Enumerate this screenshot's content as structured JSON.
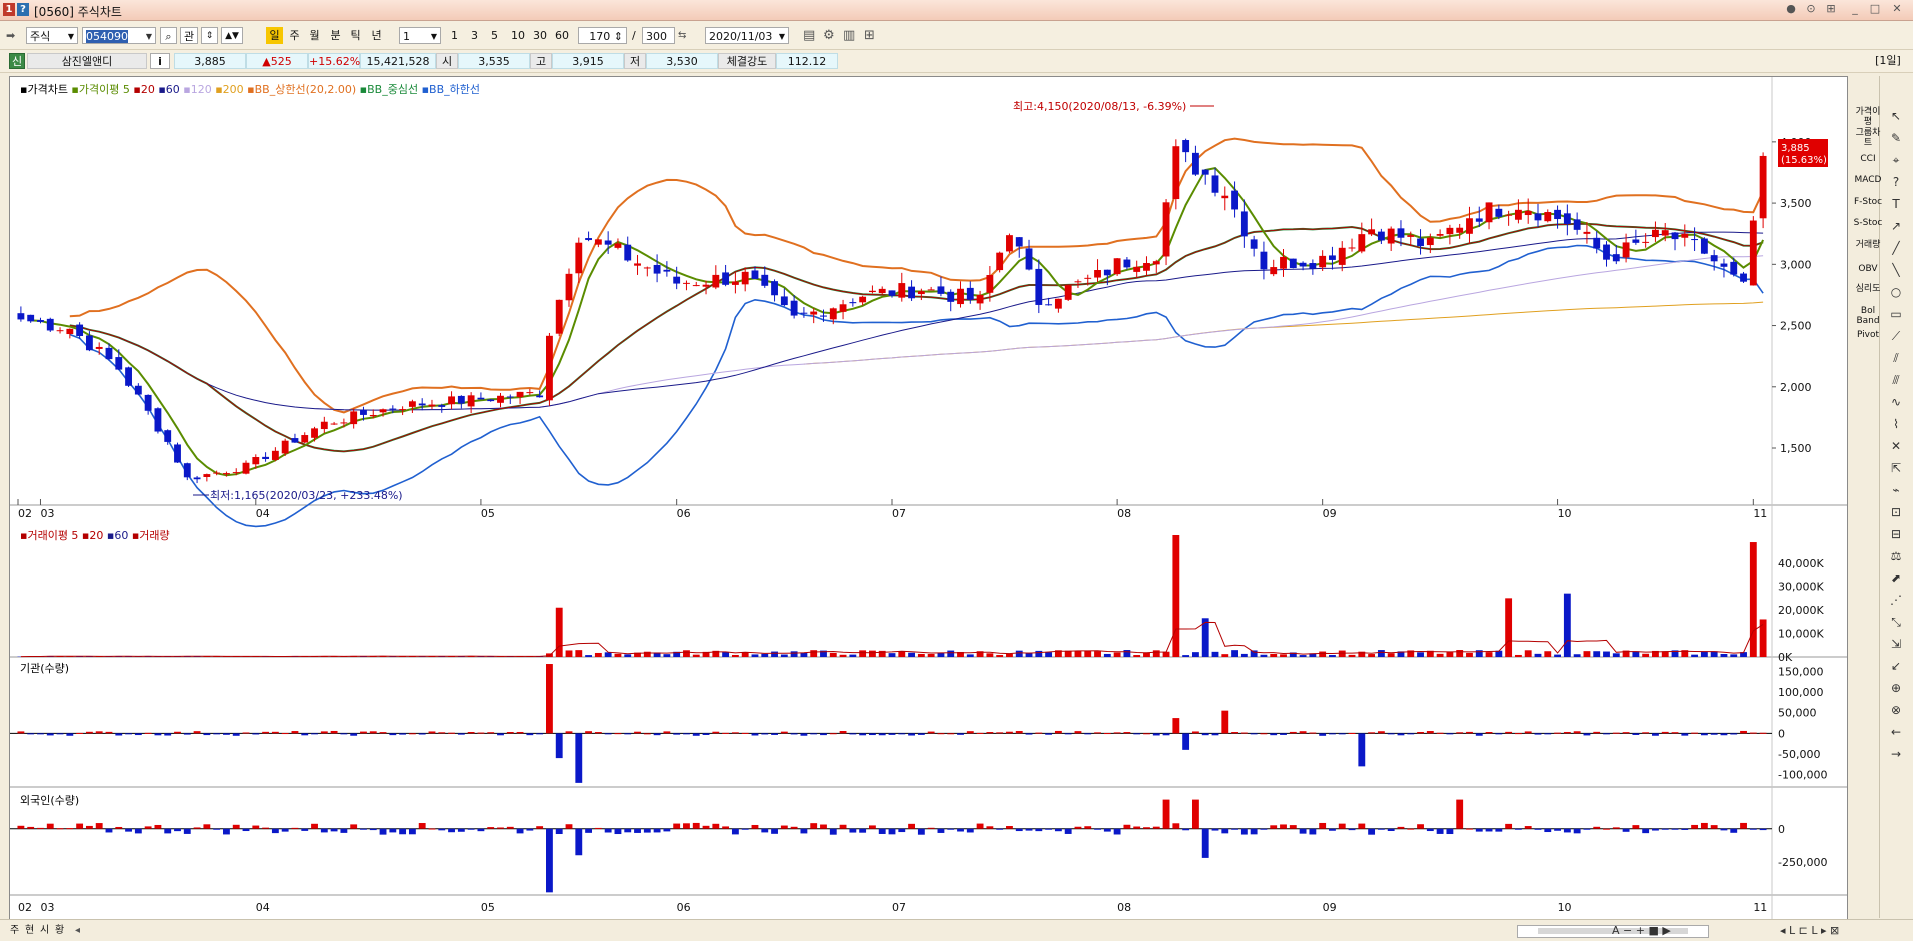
{
  "window": {
    "code": "[0560]",
    "title": "주식차트"
  },
  "toolbar": {
    "market": "주식",
    "code": "054090",
    "kwan_label": "관",
    "periods": [
      "일",
      "주",
      "월",
      "분",
      "틱",
      "년"
    ],
    "tick_value": "1",
    "minute_opts": [
      "1",
      "3",
      "5",
      "10",
      "30",
      "60"
    ],
    "count": "170",
    "total": "300",
    "date": "2020/11/03"
  },
  "info": {
    "badge": "신",
    "name": "삼진엘앤디",
    "info_btn": "i",
    "price": "3,885",
    "change": "▲525",
    "change_pct": "+15.62%",
    "volume": "15,421,528",
    "open_label": "시",
    "open": "3,535",
    "high_label": "고",
    "high": "3,915",
    "low_label": "저",
    "low": "3,530",
    "strength_label": "체결강도",
    "strength": "112.12",
    "period_tag": "[1일]"
  },
  "panes": {
    "price": {
      "legend": [
        {
          "text": "가격차트",
          "color": "#000000"
        },
        {
          "text": "가격이평 5",
          "color": "#5a8c00"
        },
        {
          "text": "20",
          "color": "#b40000"
        },
        {
          "text": "60",
          "color": "#1a1a8a"
        },
        {
          "text": "120",
          "color": "#b9a6e0"
        },
        {
          "text": "200",
          "color": "#e0a020"
        },
        {
          "text": "BB_상한선(20,2.00)",
          "color": "#e07020"
        },
        {
          "text": "BB_중심선",
          "color": "#1a8a3a"
        },
        {
          "text": "BB_하한선",
          "color": "#2060d0"
        }
      ],
      "high_note": "최고:4,150(2020/08/13, -6.39%)",
      "low_note": "최저:1,165(2020/03/23, +233.48%)",
      "price_tag": "3,885",
      "price_tag_pct": "(15.63%)"
    },
    "volume": {
      "legend": [
        {
          "text": "거래이평 5",
          "color": "#b40000"
        },
        {
          "text": "20",
          "color": "#b40000"
        },
        {
          "text": "60",
          "color": "#1a1a8a"
        },
        {
          "text": "거래량",
          "color": "#b40000"
        }
      ]
    },
    "inst": {
      "legend": "기관(수량)"
    },
    "foreign": {
      "legend": "외국인(수량)"
    }
  },
  "chart_data": [
    {
      "type": "candlestick",
      "title": "가격차트",
      "x_month_labels": [
        "02",
        "03",
        "04",
        "05",
        "06",
        "07",
        "08",
        "09",
        "10",
        "11"
      ],
      "y_ticks": [
        1500,
        2000,
        2500,
        3000,
        3500,
        4000
      ],
      "ylim": [
        1100,
        4350
      ],
      "series": [
        {
          "name": "종가",
          "x_month_start": [
            "2020-02-28",
            "2020-03-02",
            "2020-04-01",
            "2020-05-04",
            "2020-06-01",
            "2020-07-01",
            "2020-08-03",
            "2020-09-01",
            "2020-10-05",
            "2020-11-02"
          ],
          "close_approx": [
            2550,
            2450,
            1900,
            1950,
            3000,
            2750,
            3700,
            3250,
            3150,
            3885
          ]
        },
        {
          "name": "최고",
          "value": 4150,
          "date": "2020-08-13"
        },
        {
          "name": "최저",
          "value": 1165,
          "date": "2020-03-23"
        },
        {
          "name": "현재가",
          "value": 3885
        }
      ]
    },
    {
      "type": "bar",
      "title": "거래량",
      "y_ticks": [
        0,
        10000,
        20000,
        30000,
        40000
      ],
      "y_tick_labels": [
        "0K",
        "10,000K",
        "20,000K",
        "30,000K",
        "40,000K"
      ],
      "ylim": [
        0,
        52000
      ],
      "spikes_k": [
        {
          "date": "2020-05-14",
          "value": 21000
        },
        {
          "date": "2020-08-11",
          "value": 52000
        },
        {
          "date": "2020-08-14",
          "value": 16500
        },
        {
          "date": "2020-09-28",
          "value": 25000
        },
        {
          "date": "2020-10-06",
          "value": 27000
        },
        {
          "date": "2020-11-02",
          "value": 49000
        },
        {
          "date": "2020-11-03",
          "value": 16000
        }
      ]
    },
    {
      "type": "bar",
      "title": "기관(수량)",
      "y_ticks": [
        -100000,
        -50000,
        0,
        50000,
        100000,
        150000
      ],
      "y_tick_labels": [
        "-100,000",
        "-50,000",
        "0",
        "50,000",
        "100,000",
        "150,000"
      ],
      "ylim": [
        -130000,
        185000
      ],
      "spikes": [
        {
          "date": "2020-05-13",
          "value": 168000
        },
        {
          "date": "2020-05-14",
          "value": -60000
        },
        {
          "date": "2020-05-18",
          "value": -120000
        },
        {
          "date": "2020-08-11",
          "value": 37000
        },
        {
          "date": "2020-08-12",
          "value": -40000
        },
        {
          "date": "2020-08-18",
          "value": 55000
        },
        {
          "date": "2020-09-07",
          "value": -80000
        }
      ]
    },
    {
      "type": "bar",
      "title": "외국인(수량)",
      "y_ticks": [
        -250000,
        0
      ],
      "y_tick_labels": [
        "-250,000",
        "0"
      ],
      "ylim": [
        -500000,
        300000
      ],
      "spikes": [
        {
          "date": "2020-05-13",
          "value": -480000
        },
        {
          "date": "2020-05-18",
          "value": -200000
        },
        {
          "date": "2020-08-10",
          "value": 220000
        },
        {
          "date": "2020-08-13",
          "value": 220000
        },
        {
          "date": "2020-08-14",
          "value": -220000
        },
        {
          "date": "2020-09-21",
          "value": 220000
        }
      ]
    }
  ],
  "right_indicators": [
    "가격이평",
    "그룹차트",
    "CCI",
    "MACD",
    "F-Stoc",
    "S-Stoc",
    "거래량",
    "OBV",
    "심리도",
    "Bol Band",
    "Pivot"
  ],
  "bottom_tabs": [
    "주",
    "현",
    "시",
    "황"
  ]
}
